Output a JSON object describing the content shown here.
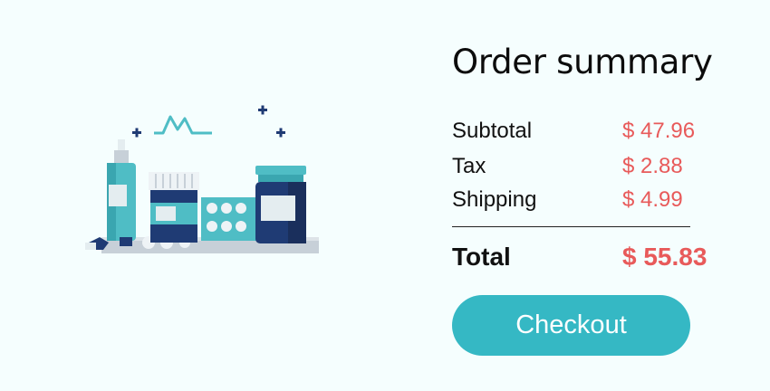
{
  "illustration": {
    "icon": "pharmacy-medicine-bottles-illustration",
    "colors": {
      "teal": "#4fbdc5",
      "navy": "#1f3b74",
      "light": "#e4edf0",
      "shelf": "#c7d0d8"
    }
  },
  "summary": {
    "title": "Order summary",
    "rows": [
      {
        "label": "Subtotal",
        "value": "$ 47.96"
      },
      {
        "label": "Tax",
        "value": "$ 2.88"
      },
      {
        "label": "Shipping",
        "value": "$ 4.99"
      }
    ],
    "total": {
      "label": "Total",
      "value": "$ 55.83"
    },
    "checkout_label": "Checkout"
  },
  "colors": {
    "background": "#f5fefe",
    "price": "#e85a5a",
    "button": "#35b8c4",
    "button_text": "#ffffff"
  }
}
